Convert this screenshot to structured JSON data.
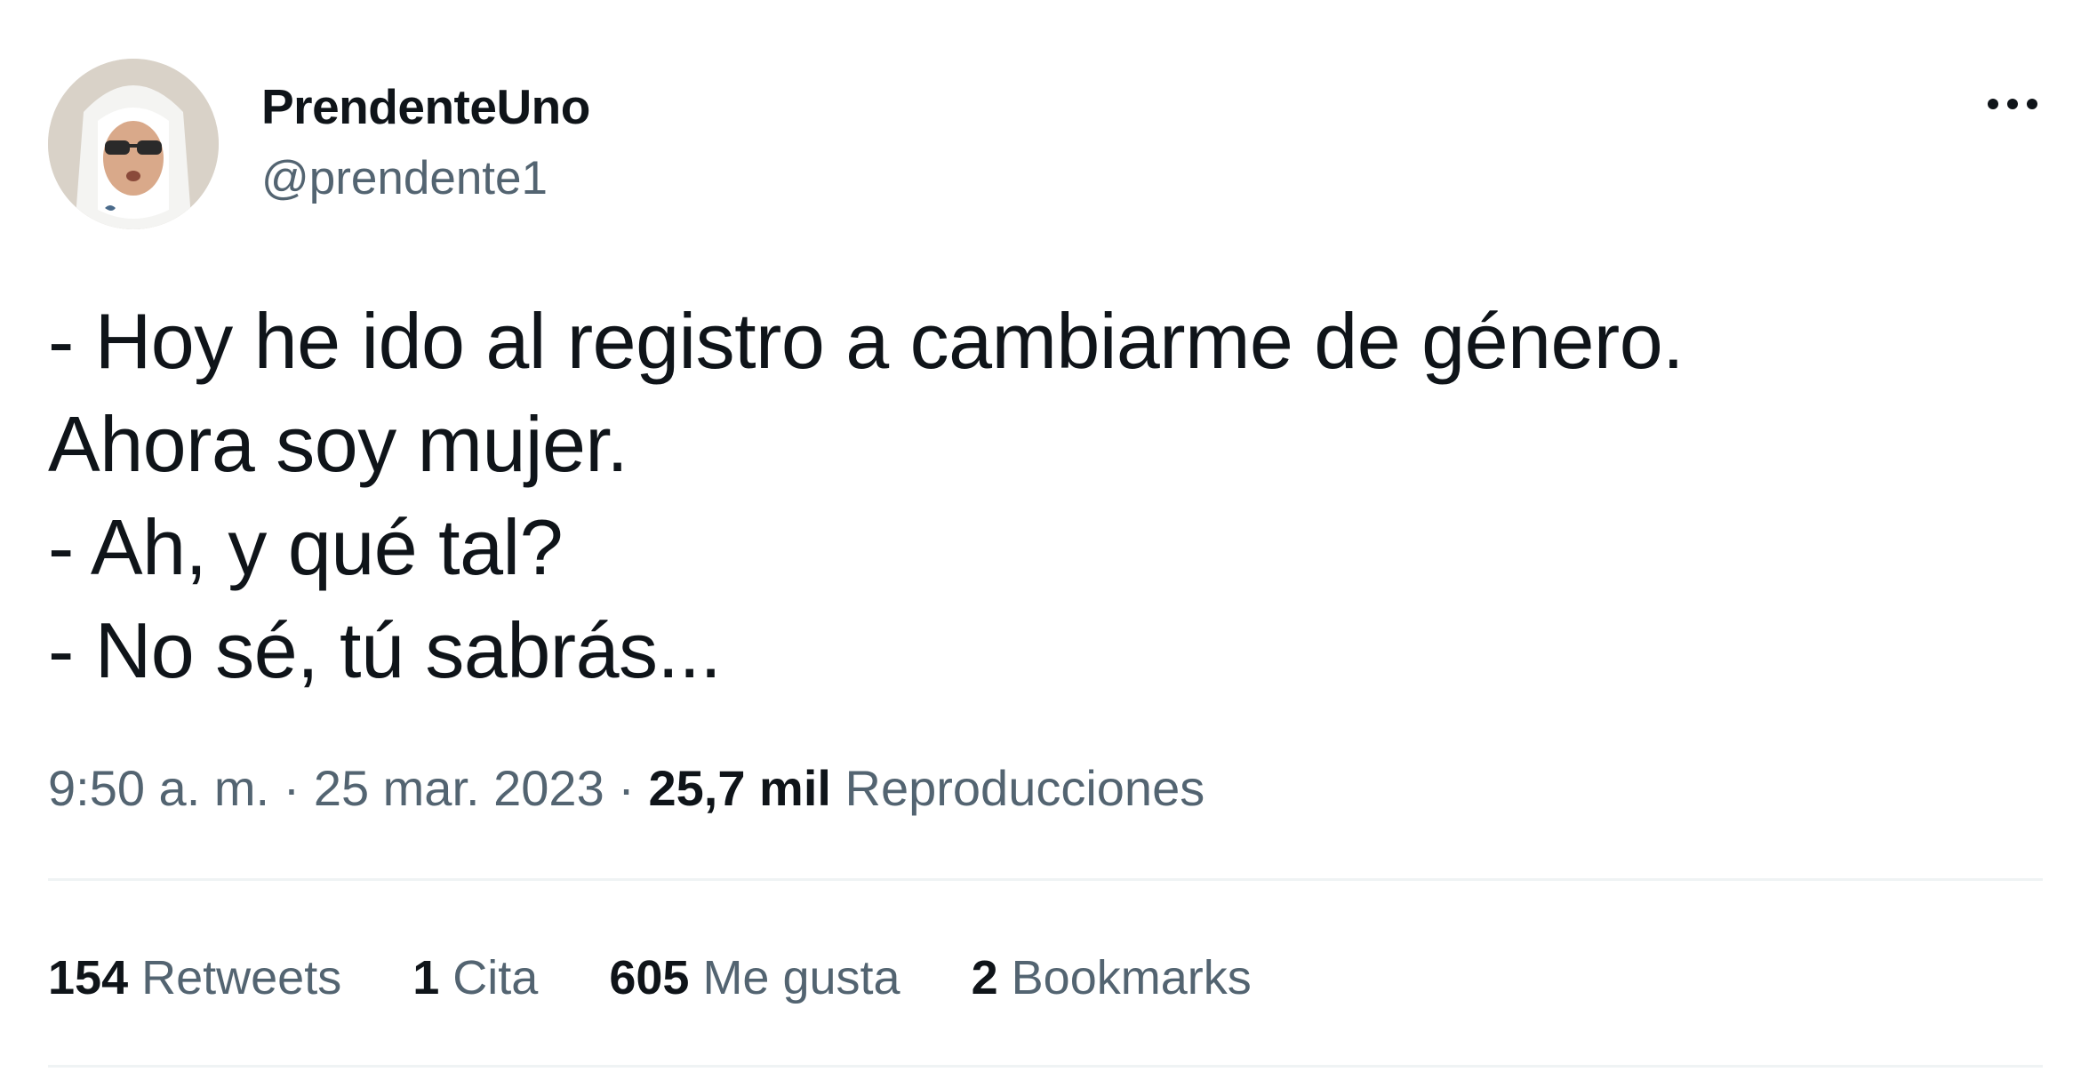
{
  "author": {
    "display_name": "PrendenteUno",
    "handle": "@prendente1",
    "avatar_icon": "avatar-nun-sunglasses"
  },
  "menu": {
    "more_icon": "more-horizontal-icon"
  },
  "tweet": {
    "lines": [
      "- Hoy he ido al registro a cambiarme de género.",
      "Ahora soy mujer.",
      "- Ah, y qué tal?",
      "- No sé, tú sabrás..."
    ]
  },
  "meta": {
    "time": "9:50 a. m.",
    "separator": "·",
    "date": "25 mar. 2023",
    "views_count": "25,7 mil",
    "views_label": "Reproducciones"
  },
  "stats": [
    {
      "count": "154",
      "label": "Retweets"
    },
    {
      "count": "1",
      "label": "Cita"
    },
    {
      "count": "605",
      "label": "Me gusta"
    },
    {
      "count": "2",
      "label": "Bookmarks"
    }
  ],
  "colors": {
    "text_primary": "#0f1419",
    "text_secondary": "#536471",
    "divider": "#eff3f4",
    "background": "#ffffff"
  }
}
